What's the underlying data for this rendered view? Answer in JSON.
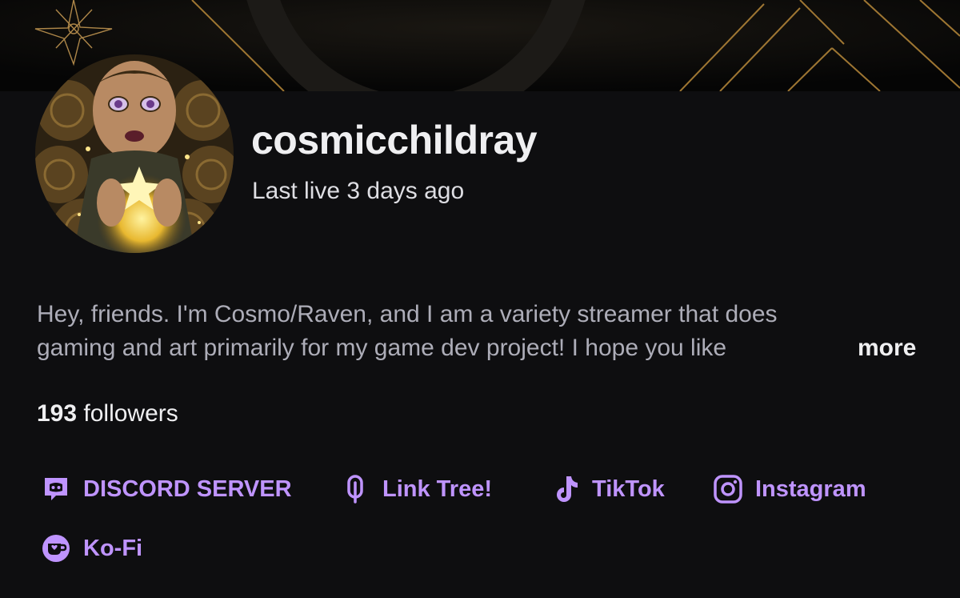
{
  "channel": {
    "username": "cosmicchildray",
    "last_live": "Last live 3 days ago",
    "bio_line_1": "Hey, friends. I'm Cosmo/Raven, and I am a variety streamer that does",
    "bio_line_2": "gaming and art primarily for my game dev project! I hope you like",
    "more_label": "more",
    "followers_count": "193",
    "followers_label": " followers"
  },
  "social_links": [
    {
      "label": "DISCORD SERVER",
      "icon": "discord-icon"
    },
    {
      "label": "Link Tree!",
      "icon": "linktree-icon"
    },
    {
      "label": "TikTok",
      "icon": "tiktok-icon"
    },
    {
      "label": "Instagram",
      "icon": "instagram-icon"
    },
    {
      "label": "Ko-Fi",
      "icon": "kofi-icon"
    }
  ],
  "colors": {
    "background": "#0e0e10",
    "accent": "#bf94ff",
    "text_primary": "#efeff1",
    "text_secondary": "#adadb8",
    "banner_gold": "#b8893a"
  }
}
